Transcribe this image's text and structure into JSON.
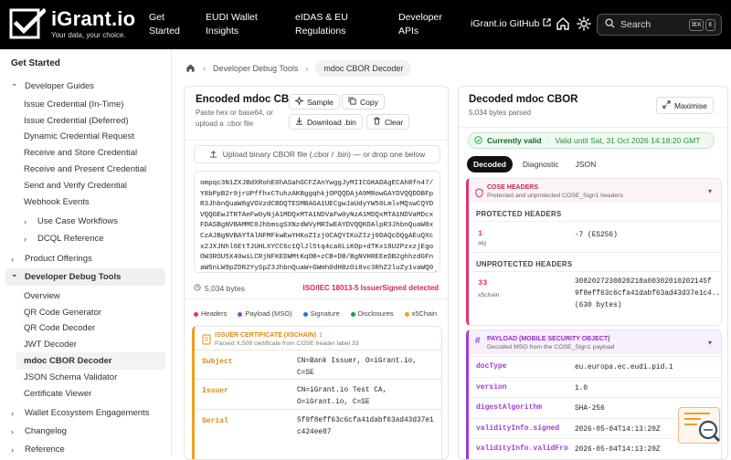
{
  "brand": {
    "name": "iGrant.io",
    "tagline": "Your data, your choice."
  },
  "nav": {
    "links": [
      {
        "id": "get-started",
        "l1": "Get",
        "l2": "Started"
      },
      {
        "id": "eudi",
        "l1": "EUDI Wallet",
        "l2": "Insights"
      },
      {
        "id": "eidas",
        "l1": "eIDAS & EU",
        "l2": "Regulations"
      },
      {
        "id": "dev-apis",
        "l1": "Developer",
        "l2": "APIs"
      }
    ],
    "github": "iGrant.io GitHub",
    "search_placeholder": "Search",
    "kbd1": "⌘K",
    "kbd2": "K"
  },
  "sidebar": {
    "heading": "Get Started",
    "items": [
      {
        "label": "Developer Guides",
        "chev": "⌄"
      },
      {
        "label": "Issue Credential (In-Time)"
      },
      {
        "label": "Issue Credential (Deferred)"
      },
      {
        "label": "Dynamic Credential Request"
      },
      {
        "label": "Receive and Store Credential"
      },
      {
        "label": "Receive and Present Credential"
      },
      {
        "label": "Send and Verify Credential"
      },
      {
        "label": "Webhook Events"
      },
      {
        "label": "Use Case Workflows",
        "chev": "›"
      },
      {
        "label": "DCQL Reference",
        "chev": "›"
      },
      {
        "label": "Product Offerings",
        "chev": "›"
      },
      {
        "label": "Developer Debug Tools",
        "chev": "⌄"
      },
      {
        "label": "Overview"
      },
      {
        "label": "QR Code Generator"
      },
      {
        "label": "QR Code Decoder"
      },
      {
        "label": "JWT Decoder"
      },
      {
        "label": "mdoc CBOR Decoder"
      },
      {
        "label": "JSON Schema Validator"
      },
      {
        "label": "Certificate Viewer"
      },
      {
        "label": "Wallet Ecosystem Engagements",
        "chev": "›"
      },
      {
        "label": "Changelog",
        "chev": "›"
      },
      {
        "label": "Reference",
        "chev": "›"
      }
    ]
  },
  "breadcrumb": {
    "parent": "Developer Debug Tools",
    "current": "mdoc CBOR Decoder"
  },
  "encoded": {
    "title": "Encoded mdoc CBOR",
    "sub1": "Paste hex or base64, or",
    "sub2": "upload a .cbor file",
    "sample": "Sample",
    "copy": "Copy",
    "download": "Download .bin",
    "clear": "Clear",
    "upload": "Upload binary CBOR file (.cbor / .bin) — or drop one below",
    "data_lines": [
      "ompqc3N1ZXJBdXRohE0hASahGCFZAnYwggJyMIICGKADAgECAhRfn47/",
      "Y8bPpB2r9jrUPffhxCTuhzAKBggqhkjOPQQDAjA9MRowGAYDVQQDDBFp",
      "R3JhbnQuaW8gVGVzdCBDQTESMBAGA1UECgwJaUdyYW50LmlvMQswCQYD",
      "VQQGEwJTRTAeFw0yNjA1MDQxMTA1NDVaFw0yNzA1MDQxMTA1NDVaMDcx",
      "FDASBgNVBAMMC0JhbmsgSXNzdWVyMRIwEAYDVQQKDAlpR3JhbnQuaW8x",
      "CzAJBgNVBAYTAlNFMFkwEwYHKoZIzj0CAQYIKoZIzj0DAQcDQgAEuQXc",
      "x2JXJNhl6EtTJUHLXYCC6c1QlJl5tq4ca0LiKOp+dTKx18U2PzxzjEgo",
      "OW3ROU5X40wiLCRjNFKEDWMtKqOB+zCB+DB/BgNVHREEeDB2ghhzdGFn",
      "aW5nLW9pZDR2YySpZ3JhbnQuaW+GWmh0dHBzOi8vc3RhZ2luZy1vaWQ0"
    ],
    "size": "5,034 bytes",
    "detected": "ISO/IEC 18013-5 IssuerSigned detected",
    "legend": [
      {
        "label": "Headers",
        "color": "#e0336b"
      },
      {
        "label": "Payload (MSO)",
        "color": "#a23bd6"
      },
      {
        "label": "Signature",
        "color": "#1f7de0"
      },
      {
        "label": "Disclosures",
        "color": "#16a34a"
      },
      {
        "label": "x5Chain",
        "color": "#f0a020"
      }
    ],
    "cert": {
      "title": "ISSUER CERTIFICATE (X5CHAIN)",
      "count": "1",
      "sub": "Parsed X.509 certificate from COSE header label 33",
      "rows": [
        {
          "k": "Subject",
          "v1": "CN=Bank Issuer, O=iGrant.io,",
          "v2": "C=SE"
        },
        {
          "k": "Issuer",
          "v1": "CN=iGrant.io Test CA,",
          "v2": "O=iGrant.io, C=SE"
        },
        {
          "k": "Serial",
          "v1": "5f9f8eff63c6cfa41dabf63ad43d37e1",
          "v2": "c424ee87"
        }
      ]
    }
  },
  "decoded": {
    "title": "Decoded mdoc CBOR",
    "sub": "5,034 bytes parsed",
    "maximise": "Maximise",
    "valid": "Currently valid",
    "valid_until": "Valid until Sat, 31 Oct 2026 14:18:20 GMT",
    "tabs": [
      "Decoded",
      "Diagnostic",
      "JSON"
    ],
    "cose": {
      "title": "COSE HEADERS",
      "sub": "Protected and unprotected COSE_Sign1 headers",
      "protected": "PROTECTED HEADERS",
      "alg_key": "1",
      "alg_name": "alg",
      "alg_val": "-7 (ES256)",
      "unprotected": "UNPROTECTED HEADERS",
      "x5_key": "33",
      "x5_name": "x5chain",
      "x5_v1": "3082027230820218a00302010202145f",
      "x5_v2": "9f8eff63c6cfa41dabf63ad43d37e1c4...",
      "x5_v3": "(630 bytes)"
    },
    "payload": {
      "title": "PAYLOAD (MOBILE SECURITY OBJECT)",
      "sub": "Decoded MSO from the COSE_Sign1 payload",
      "rows": [
        {
          "k": "docType",
          "v": "eu.europa.ec.eudi.pid.1"
        },
        {
          "k": "version",
          "v": "1.0"
        },
        {
          "k": "digestAlgorithm",
          "v": "SHA-256"
        },
        {
          "k": "validityInfo.signed",
          "v": "2026-05-04T14:13:20Z"
        },
        {
          "k": "validityInfo.validFro",
          "v": "2026-05-04T14:13:20Z"
        }
      ]
    }
  },
  "colors": {
    "accent": "#e0336b",
    "orange": "#f0a020",
    "purple": "#a23bd6",
    "green": "#16a34a"
  }
}
